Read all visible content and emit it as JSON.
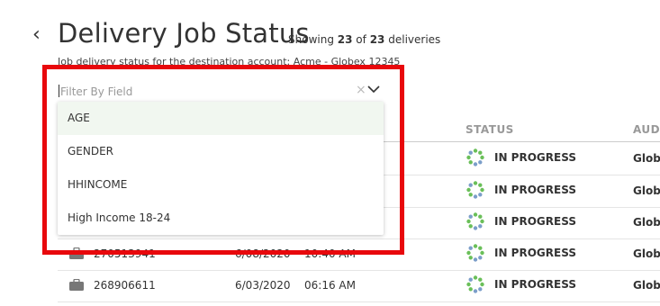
{
  "header": {
    "back_label": "‹",
    "title": "Delivery Job Status",
    "showing_prefix": "Showing",
    "showing_count": "23",
    "showing_of": "of",
    "showing_total": "23",
    "showing_suffix": "deliveries",
    "subtitle": "Job delivery status for the destination account: Acme - Globex 12345"
  },
  "table": {
    "columns": {
      "status": "STATUS",
      "audience": "AUDI"
    },
    "rows": [
      {
        "status": "IN PROGRESS",
        "audience": "Globe"
      },
      {
        "status": "IN PROGRESS",
        "audience": "Globe"
      },
      {
        "status": "IN PROGRESS",
        "audience": "Globe"
      },
      {
        "job_id": "270513941",
        "date": "6/08/2020",
        "time": "10:40 AM",
        "status": "IN PROGRESS",
        "audience": "Globe"
      },
      {
        "job_id": "268906611",
        "date": "6/03/2020",
        "time": "06:16 AM",
        "status": "IN PROGRESS",
        "audience": "Globe"
      }
    ]
  },
  "filter": {
    "placeholder": "Filter By Field",
    "clear_icon": "×",
    "options": [
      "AGE",
      "GENDER",
      "HHINCOME",
      "High Income 18-24"
    ]
  },
  "colors": {
    "highlight": "#e8080c",
    "spinner_green": "#6abf59",
    "spinner_blue": "#7b9ec9",
    "active_option": "#f1f7f0"
  }
}
